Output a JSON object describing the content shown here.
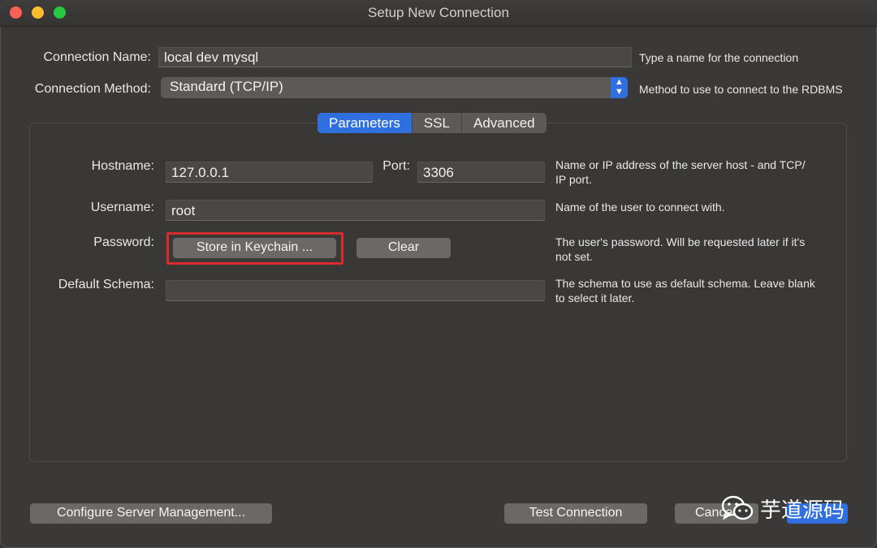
{
  "window": {
    "title": "Setup New Connection"
  },
  "connection_name": {
    "label": "Connection Name:",
    "value": "local dev mysql",
    "hint": "Type a name for the connection"
  },
  "connection_method": {
    "label": "Connection Method:",
    "value": "Standard (TCP/IP)",
    "hint": "Method to use to connect to the RDBMS"
  },
  "tabs": [
    {
      "label": "Parameters",
      "active": true
    },
    {
      "label": "SSL",
      "active": false
    },
    {
      "label": "Advanced",
      "active": false
    }
  ],
  "params": {
    "hostname": {
      "label": "Hostname:",
      "value": "127.0.0.1"
    },
    "port": {
      "label": "Port:",
      "value": "3306"
    },
    "hostname_hint": "Name or IP address of the server host - and TCP/IP port.",
    "hostname_hint_line1": "Name or IP address of the server host - and TCP/",
    "hostname_hint_line2": "IP port.",
    "username": {
      "label": "Username:",
      "value": "root",
      "hint": "Name of the user to connect with."
    },
    "password": {
      "label": "Password:",
      "store_button": "Store in Keychain ...",
      "clear_button": "Clear",
      "hint_line1": "The user's password. Will be requested later if it's",
      "hint_line2": "not set."
    },
    "schema": {
      "label": "Default Schema:",
      "value": "",
      "hint_line1": "The schema to use as default schema. Leave blank",
      "hint_line2": "to select it later."
    }
  },
  "footer": {
    "configure_button": "Configure Server Management...",
    "test_button": "Test Connection",
    "cancel_button": "Cance",
    "ok_button": ""
  },
  "watermark": {
    "text": "芋道源码"
  },
  "colors": {
    "accent": "#2f6fe0",
    "highlight": "#d92b2b"
  }
}
